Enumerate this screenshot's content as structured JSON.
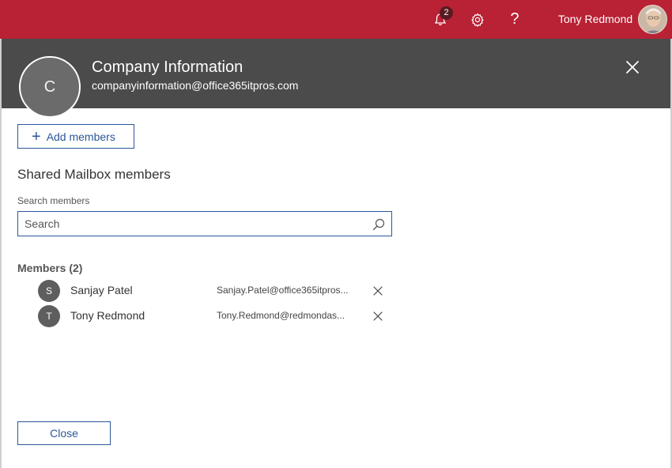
{
  "topbar": {
    "notification_count": "2",
    "help_label": "?",
    "user_name": "Tony Redmond",
    "icons": [
      "bell-icon",
      "gear-icon",
      "help-icon",
      "avatar"
    ]
  },
  "panel": {
    "avatar_initial": "C",
    "title": "Company Information",
    "email": "companyinformation@office365itpros.com",
    "add_members_label": "Add members",
    "section_title": "Shared Mailbox members",
    "search_label": "Search members",
    "search_placeholder": "Search",
    "members_heading": "Members (2)",
    "members": [
      {
        "initial": "S",
        "name": "Sanjay Patel",
        "email": "Sanjay.Patel@office365itpros..."
      },
      {
        "initial": "T",
        "name": "Tony Redmond",
        "email": "Tony.Redmond@redmondas..."
      }
    ],
    "close_label": "Close"
  },
  "colors": {
    "topbar": "#b92134",
    "header": "#4b4b4b",
    "accent": "#2b579a"
  }
}
